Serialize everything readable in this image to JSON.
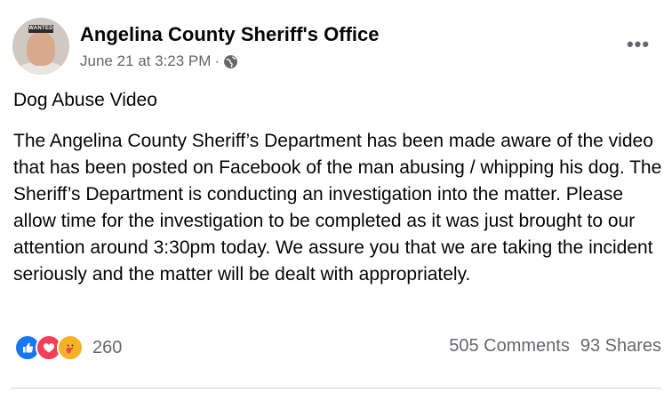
{
  "post": {
    "author": "Angelina County Sheriff's Office",
    "avatar_tag": "WANTED",
    "timestamp": "June 21 at 3:23 PM",
    "separator": "·",
    "audience_icon": "globe-icon",
    "more_icon": "more-options-icon",
    "more_label": "•••",
    "title": "Dog Abuse Video",
    "body": "The Angelina County Sheriff’s Department has been made aware of the video that has been posted on Facebook of the man abusing / whipping his dog. The Sheriff’s Department is conducting an investigation into the matter. Please allow time for the investigation to be completed as it was just brought to our attention around 3:30pm today. We assure you that we are taking the incident seriously and the matter will be dealt with appropriately."
  },
  "footer": {
    "reaction_icons": [
      "like-icon",
      "love-icon",
      "care-icon"
    ],
    "reaction_count": "260",
    "comments": "505 Comments",
    "shares": "93 Shares"
  },
  "colors": {
    "text": "#050505",
    "secondary": "#65676b",
    "like": "#1877f2",
    "love": "#f33e58",
    "care": "#f7b125"
  }
}
